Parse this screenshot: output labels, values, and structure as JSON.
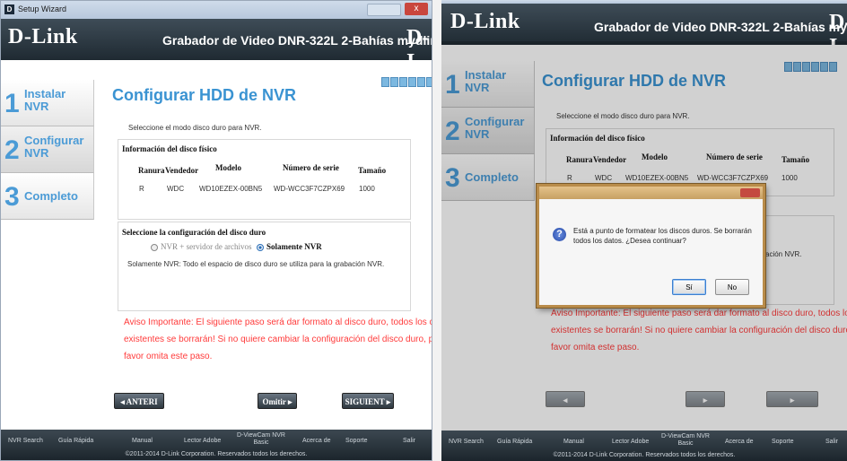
{
  "window": {
    "title": "Setup Wizard",
    "close_label": "x"
  },
  "brand": {
    "logo": "D-Link",
    "logo_right": "D-I",
    "header_title": "Grabador de Video DNR-322L 2-Bahías mydlink"
  },
  "steps": [
    {
      "num": "1",
      "label": "Instalar NVR"
    },
    {
      "num": "2",
      "label": "Configurar NVR"
    },
    {
      "num": "3",
      "label": "Completo"
    }
  ],
  "page": {
    "heading": "Configurar HDD de NVR",
    "intro": "Seleccione el modo disco duro para NVR.",
    "disk_info_title": "Información del disco físico",
    "columns": [
      "Ranura",
      "Vendedor",
      "Modelo",
      "Número de serie",
      "Tamaño"
    ],
    "rows": [
      [
        "R",
        "WDC",
        "WD10EZEX-00BN5",
        "WD-WCC3F7CZPX69",
        "1000"
      ]
    ],
    "config_title": "Seleccione la configuración del disco duro",
    "option_nvr_file": "NVR + servidor de archivos",
    "option_nvr_only": "Solamente NVR",
    "nvr_only_desc": "Solamente NVR: Todo el espacio de disco duro se utiliza para la grabación NVR.",
    "desc_partial": "ación NVR.",
    "warning_left": [
      "Aviso Importante: El siguiente paso será dar formato al disco duro, todos los c",
      "existentes se borrarán! Si no quiere cambiar la configuración del disco duro, p",
      "favor omita este paso."
    ],
    "warning_right": [
      "Aviso Importante: El siguiente paso será dar formato al disco duro, todos los c",
      "existentes se borrarán! Si no quiere cambiar la configuración del disco duro, p",
      "favor omita este paso."
    ]
  },
  "buttons": {
    "back": "ANTERI",
    "skip": "Omitir",
    "next": "SIGUIENT"
  },
  "footer": {
    "nav": [
      "NVR Search",
      "Guía Rápida",
      "Manual",
      "Lector Adobe",
      "D-ViewCam NVR Basic",
      "Acerca de",
      "Soporte",
      "Salir"
    ],
    "copyright": "©2011-2014 D-Link Corporation. Reservados todos los derechos."
  },
  "dialog": {
    "message": "Está a punto de formatear los discos duros. Se borrarán todos los datos. ¿Desea continuar?",
    "yes": "Sí",
    "no": "No"
  },
  "colors": {
    "accent": "#3a93d2",
    "warning": "#ff3b3b",
    "header": "#26323a"
  }
}
